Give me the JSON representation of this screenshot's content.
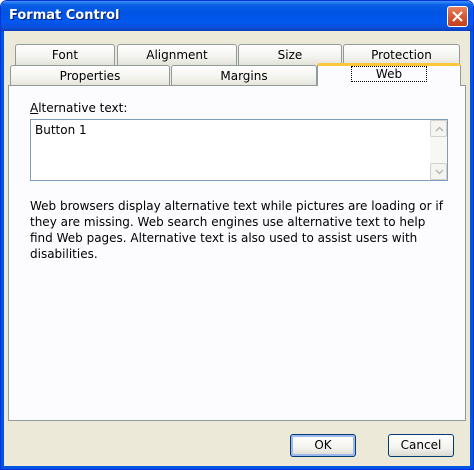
{
  "window": {
    "title": "Format Control"
  },
  "tabs_row1": [
    "Font",
    "Alignment",
    "Size",
    "Protection"
  ],
  "tabs_row2": [
    "Properties",
    "Margins",
    "Web"
  ],
  "active_tab": "Web",
  "web_tab": {
    "alt_label_mnemonic": "A",
    "alt_label_rest": "lternative text:",
    "alt_text_value": "Button 1",
    "description": "Web browsers display alternative text while pictures are loading or if they are missing.  Web search engines use alternative text to help find Web pages.  Alternative text is also used to assist users with disabilities."
  },
  "buttons": {
    "ok": "OK",
    "cancel": "Cancel"
  },
  "colors": {
    "titlebar": "#0054e3",
    "active_tab_highlight": "#ffc83c",
    "close_button": "#d55a35"
  },
  "icons": {
    "close": "close-icon",
    "scroll_up": "chevron-up-icon",
    "scroll_down": "chevron-down-icon"
  }
}
